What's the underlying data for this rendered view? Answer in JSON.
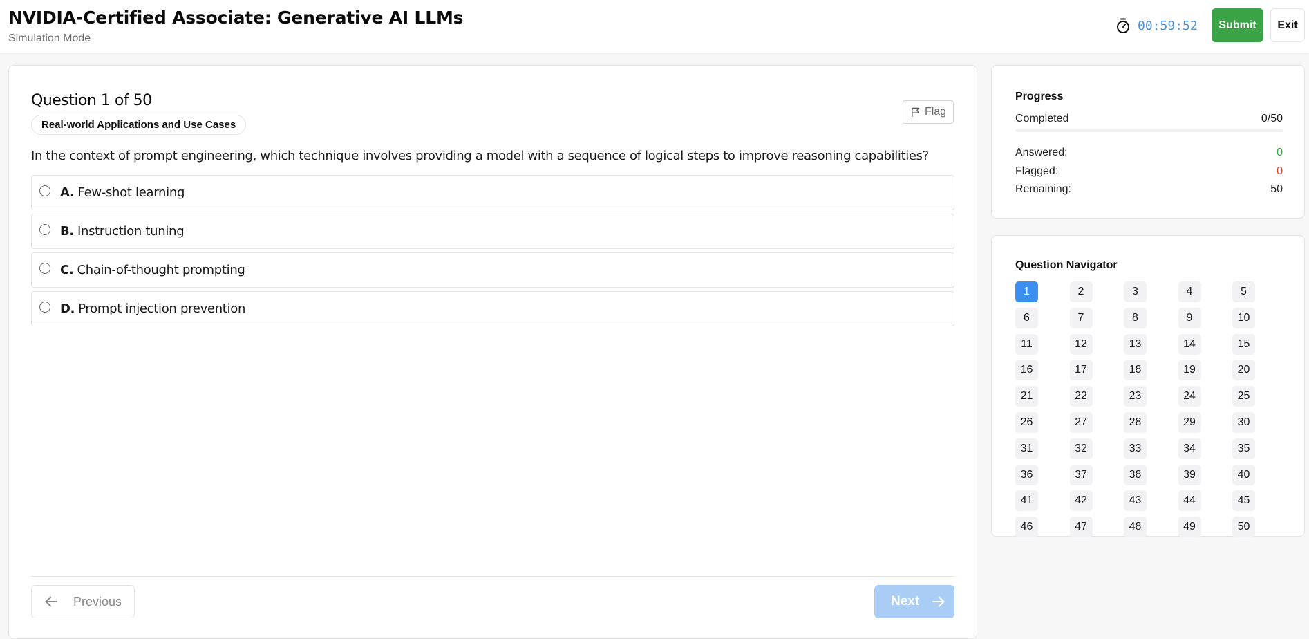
{
  "header": {
    "title": "NVIDIA-Certified Associate: Generative AI LLMs",
    "subtitle": "Simulation Mode",
    "timer": "00:59:52",
    "submit_label": "Submit",
    "exit_label": "Exit"
  },
  "question": {
    "number_label": "Question 1 of 50",
    "topic": "Real-world Applications and Use Cases",
    "flag_label": "Flag",
    "text": "In the context of prompt engineering, which technique involves providing a model with a sequence of logical steps to improve reasoning capabilities?",
    "options": [
      {
        "letter": "A.",
        "text": "Few-shot learning"
      },
      {
        "letter": "B.",
        "text": "Instruction tuning"
      },
      {
        "letter": "C.",
        "text": "Chain-of-thought prompting"
      },
      {
        "letter": "D.",
        "text": "Prompt injection prevention"
      }
    ]
  },
  "footer": {
    "previous_label": "Previous",
    "next_label": "Next"
  },
  "progress": {
    "title": "Progress",
    "completed_label": "Completed",
    "completed_value": "0/50",
    "completed_fraction": 0,
    "answered_label": "Answered:",
    "answered_value": "0",
    "flagged_label": "Flagged:",
    "flagged_value": "0",
    "remaining_label": "Remaining:",
    "remaining_value": "50"
  },
  "navigator": {
    "title": "Question Navigator",
    "current": 1,
    "total": 50
  },
  "colors": {
    "accent": "#3b8ff3",
    "submit": "#3aa346",
    "answered": "#3aa346",
    "flagged": "#d93a2b",
    "timer": "#4a90d9"
  }
}
